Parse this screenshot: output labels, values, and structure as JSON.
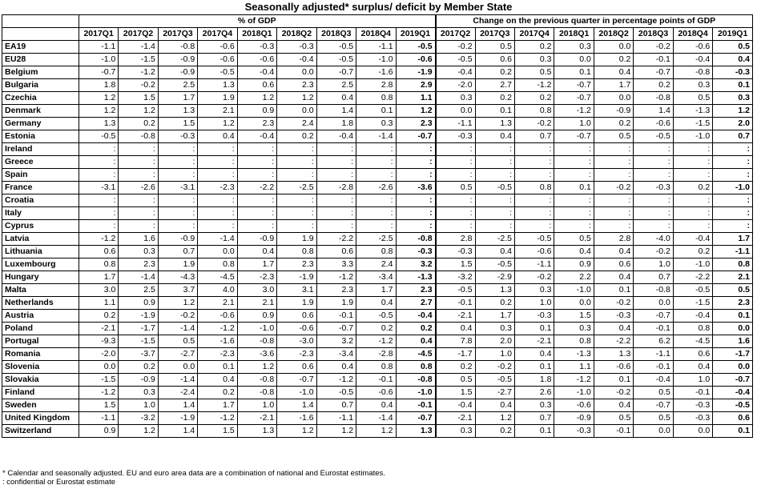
{
  "title": "Seasonally adjusted* surplus/ deficit by Member State",
  "group_headers": {
    "left": "% of GDP",
    "right": "Change on the previous quarter in percentage points of GDP"
  },
  "left_columns": [
    "2017Q1",
    "2017Q2",
    "2017Q3",
    "2017Q4",
    "2018Q1",
    "2018Q2",
    "2018Q3",
    "2018Q4",
    "2019Q1"
  ],
  "right_columns": [
    "2017Q2",
    "2017Q3",
    "2017Q4",
    "2018Q1",
    "2018Q2",
    "2018Q3",
    "2018Q4",
    "2019Q1"
  ],
  "rows": [
    {
      "country": "EA19",
      "left": [
        "-1.1",
        "-1.4",
        "-0.8",
        "-0.6",
        "-0.3",
        "-0.3",
        "-0.5",
        "-1.1",
        "-0.5"
      ],
      "right": [
        "-0.2",
        "0.5",
        "0.2",
        "0.3",
        "0.0",
        "-0.2",
        "-0.6",
        "0.5"
      ]
    },
    {
      "country": "EU28",
      "left": [
        "-1.0",
        "-1.5",
        "-0.9",
        "-0.6",
        "-0.6",
        "-0.4",
        "-0.5",
        "-1.0",
        "-0.6"
      ],
      "right": [
        "-0.5",
        "0.6",
        "0.3",
        "0.0",
        "0.2",
        "-0.1",
        "-0.4",
        "0.4"
      ]
    },
    {
      "country": "Belgium",
      "left": [
        "-0.7",
        "-1.2",
        "-0.9",
        "-0.5",
        "-0.4",
        "0.0",
        "-0.7",
        "-1.6",
        "-1.9"
      ],
      "right": [
        "-0.4",
        "0.2",
        "0.5",
        "0.1",
        "0.4",
        "-0.7",
        "-0.8",
        "-0.3"
      ]
    },
    {
      "country": "Bulgaria",
      "left": [
        "1.8",
        "-0.2",
        "2.5",
        "1.3",
        "0.6",
        "2.3",
        "2.5",
        "2.8",
        "2.9"
      ],
      "right": [
        "-2.0",
        "2.7",
        "-1.2",
        "-0.7",
        "1.7",
        "0.2",
        "0.3",
        "0.1"
      ]
    },
    {
      "country": "Czechia",
      "left": [
        "1.2",
        "1.5",
        "1.7",
        "1.9",
        "1.2",
        "1.2",
        "0.4",
        "0.8",
        "1.1"
      ],
      "right": [
        "0.3",
        "0.2",
        "0.2",
        "-0.7",
        "0.0",
        "-0.8",
        "0.5",
        "0.3"
      ]
    },
    {
      "country": "Denmark",
      "left": [
        "1.2",
        "1.2",
        "1.3",
        "2.1",
        "0.9",
        "0.0",
        "1.4",
        "0.1",
        "1.2"
      ],
      "right": [
        "0.0",
        "0.1",
        "0.8",
        "-1.2",
        "-0.9",
        "1.4",
        "-1.3",
        "1.2"
      ]
    },
    {
      "country": "Germany",
      "left": [
        "1.3",
        "0.2",
        "1.5",
        "1.2",
        "2.3",
        "2.4",
        "1.8",
        "0.3",
        "2.3"
      ],
      "right": [
        "-1.1",
        "1.3",
        "-0.2",
        "1.0",
        "0.2",
        "-0.6",
        "-1.5",
        "2.0"
      ]
    },
    {
      "country": "Estonia",
      "left": [
        "-0.5",
        "-0.8",
        "-0.3",
        "0.4",
        "-0.4",
        "0.2",
        "-0.4",
        "-1.4",
        "-0.7"
      ],
      "right": [
        "-0.3",
        "0.4",
        "0.7",
        "-0.7",
        "0.5",
        "-0.5",
        "-1.0",
        "0.7"
      ]
    },
    {
      "country": "Ireland",
      "left": [
        ":",
        ":",
        ":",
        ":",
        ":",
        ":",
        ":",
        ":",
        ":"
      ],
      "right": [
        ":",
        ":",
        ":",
        ":",
        ":",
        ":",
        ":",
        ":"
      ]
    },
    {
      "country": "Greece",
      "left": [
        ":",
        ":",
        ":",
        ":",
        ":",
        ":",
        ":",
        ":",
        ":"
      ],
      "right": [
        ":",
        ":",
        ":",
        ":",
        ":",
        ":",
        ":",
        ":"
      ]
    },
    {
      "country": "Spain",
      "left": [
        ":",
        ":",
        ":",
        ":",
        ":",
        ":",
        ":",
        ":",
        ":"
      ],
      "right": [
        ":",
        ":",
        ":",
        ":",
        ":",
        ":",
        ":",
        ":"
      ]
    },
    {
      "country": "France",
      "left": [
        "-3.1",
        "-2.6",
        "-3.1",
        "-2.3",
        "-2.2",
        "-2.5",
        "-2.8",
        "-2.6",
        "-3.6"
      ],
      "right": [
        "0.5",
        "-0.5",
        "0.8",
        "0.1",
        "-0.2",
        "-0.3",
        "0.2",
        "-1.0"
      ]
    },
    {
      "country": "Croatia",
      "left": [
        ":",
        ":",
        ":",
        ":",
        ":",
        ":",
        ":",
        ":",
        ":"
      ],
      "right": [
        ":",
        ":",
        ":",
        ":",
        ":",
        ":",
        ":",
        ":"
      ]
    },
    {
      "country": "Italy",
      "left": [
        ":",
        ":",
        ":",
        ":",
        ":",
        ":",
        ":",
        ":",
        ":"
      ],
      "right": [
        ":",
        ":",
        ":",
        ":",
        ":",
        ":",
        ":",
        ":"
      ]
    },
    {
      "country": "Cyprus",
      "left": [
        ":",
        ":",
        ":",
        ":",
        ":",
        ":",
        ":",
        ":",
        ":"
      ],
      "right": [
        ":",
        ":",
        ":",
        ":",
        ":",
        ":",
        ":",
        ":"
      ]
    },
    {
      "country": "Latvia",
      "left": [
        "-1.2",
        "1.6",
        "-0.9",
        "-1.4",
        "-0.9",
        "1.9",
        "-2.2",
        "-2.5",
        "-0.8"
      ],
      "right": [
        "2.8",
        "-2.5",
        "-0.5",
        "0.5",
        "2.8",
        "-4.0",
        "-0.4",
        "1.7"
      ]
    },
    {
      "country": "Lithuania",
      "left": [
        "0.6",
        "0.3",
        "0.7",
        "0.0",
        "0.4",
        "0.8",
        "0.6",
        "0.8",
        "-0.3"
      ],
      "right": [
        "-0.3",
        "0.4",
        "-0.6",
        "0.4",
        "0.4",
        "-0.2",
        "0.2",
        "-1.1"
      ]
    },
    {
      "country": "Luxembourg",
      "left": [
        "0.8",
        "2.3",
        "1.9",
        "0.8",
        "1.7",
        "2.3",
        "3.3",
        "2.4",
        "3.2"
      ],
      "right": [
        "1.5",
        "-0.5",
        "-1.1",
        "0.9",
        "0.6",
        "1.0",
        "-1.0",
        "0.8"
      ]
    },
    {
      "country": "Hungary",
      "left": [
        "1.7",
        "-1.4",
        "-4.3",
        "-4.5",
        "-2.3",
        "-1.9",
        "-1.2",
        "-3.4",
        "-1.3"
      ],
      "right": [
        "-3.2",
        "-2.9",
        "-0.2",
        "2.2",
        "0.4",
        "0.7",
        "-2.2",
        "2.1"
      ]
    },
    {
      "country": "Malta",
      "left": [
        "3.0",
        "2.5",
        "3.7",
        "4.0",
        "3.0",
        "3.1",
        "2.3",
        "1.7",
        "2.3"
      ],
      "right": [
        "-0.5",
        "1.3",
        "0.3",
        "-1.0",
        "0.1",
        "-0.8",
        "-0.5",
        "0.5"
      ]
    },
    {
      "country": "Netherlands",
      "left": [
        "1.1",
        "0.9",
        "1.2",
        "2.1",
        "2.1",
        "1.9",
        "1.9",
        "0.4",
        "2.7"
      ],
      "right": [
        "-0.1",
        "0.2",
        "1.0",
        "0.0",
        "-0.2",
        "0.0",
        "-1.5",
        "2.3"
      ]
    },
    {
      "country": "Austria",
      "left": [
        "0.2",
        "-1.9",
        "-0.2",
        "-0.6",
        "0.9",
        "0.6",
        "-0.1",
        "-0.5",
        "-0.4"
      ],
      "right": [
        "-2.1",
        "1.7",
        "-0.3",
        "1.5",
        "-0.3",
        "-0.7",
        "-0.4",
        "0.1"
      ]
    },
    {
      "country": "Poland",
      "left": [
        "-2.1",
        "-1.7",
        "-1.4",
        "-1.2",
        "-1.0",
        "-0.6",
        "-0.7",
        "0.2",
        "0.2"
      ],
      "right": [
        "0.4",
        "0.3",
        "0.1",
        "0.3",
        "0.4",
        "-0.1",
        "0.8",
        "0.0"
      ]
    },
    {
      "country": "Portugal",
      "left": [
        "-9.3",
        "-1.5",
        "0.5",
        "-1.6",
        "-0.8",
        "-3.0",
        "3.2",
        "-1.2",
        "0.4"
      ],
      "right": [
        "7.8",
        "2.0",
        "-2.1",
        "0.8",
        "-2.2",
        "6.2",
        "-4.5",
        "1.6"
      ]
    },
    {
      "country": "Romania",
      "left": [
        "-2.0",
        "-3.7",
        "-2.7",
        "-2.3",
        "-3.6",
        "-2.3",
        "-3.4",
        "-2.8",
        "-4.5"
      ],
      "right": [
        "-1.7",
        "1.0",
        "0.4",
        "-1.3",
        "1.3",
        "-1.1",
        "0.6",
        "-1.7"
      ]
    },
    {
      "country": "Slovenia",
      "left": [
        "0.0",
        "0.2",
        "0.0",
        "0.1",
        "1.2",
        "0.6",
        "0.4",
        "0.8",
        "0.8"
      ],
      "right": [
        "0.2",
        "-0.2",
        "0.1",
        "1.1",
        "-0.6",
        "-0.1",
        "0.4",
        "0.0"
      ]
    },
    {
      "country": "Slovakia",
      "left": [
        "-1.5",
        "-0.9",
        "-1.4",
        "0.4",
        "-0.8",
        "-0.7",
        "-1.2",
        "-0.1",
        "-0.8"
      ],
      "right": [
        "0.5",
        "-0.5",
        "1.8",
        "-1.2",
        "0.1",
        "-0.4",
        "1.0",
        "-0.7"
      ]
    },
    {
      "country": "Finland",
      "left": [
        "-1.2",
        "0.3",
        "-2.4",
        "0.2",
        "-0.8",
        "-1.0",
        "-0.5",
        "-0.6",
        "-1.0"
      ],
      "right": [
        "1.5",
        "-2.7",
        "2.6",
        "-1.0",
        "-0.2",
        "0.5",
        "-0.1",
        "-0.4"
      ]
    },
    {
      "country": "Sweden",
      "left": [
        "1.5",
        "1.0",
        "1.4",
        "1.7",
        "1.0",
        "1.4",
        "0.7",
        "0.4",
        "-0.1"
      ],
      "right": [
        "-0.4",
        "0.4",
        "0.3",
        "-0.6",
        "0.4",
        "-0.7",
        "-0.3",
        "-0.5"
      ]
    },
    {
      "country": "United Kingdom",
      "left": [
        "-1.1",
        "-3.2",
        "-1.9",
        "-1.2",
        "-2.1",
        "-1.6",
        "-1.1",
        "-1.4",
        "-0.7"
      ],
      "right": [
        "-2.1",
        "1.2",
        "0.7",
        "-0.9",
        "0.5",
        "0.5",
        "-0.3",
        "0.6"
      ]
    },
    {
      "country": "Switzerland",
      "left": [
        "0.9",
        "1.2",
        "1.4",
        "1.5",
        "1.3",
        "1.2",
        "1.2",
        "1.2",
        "1.3"
      ],
      "right": [
        "0.3",
        "0.2",
        "0.1",
        "-0.3",
        "-0.1",
        "0.0",
        "0.0",
        "0.1"
      ]
    }
  ],
  "footnotes": [
    "*  Calendar and seasonally adjusted. EU and euro area data are a combination of national and Eurostat estimates.",
    ":  confidential or Eurostat estimate"
  ]
}
